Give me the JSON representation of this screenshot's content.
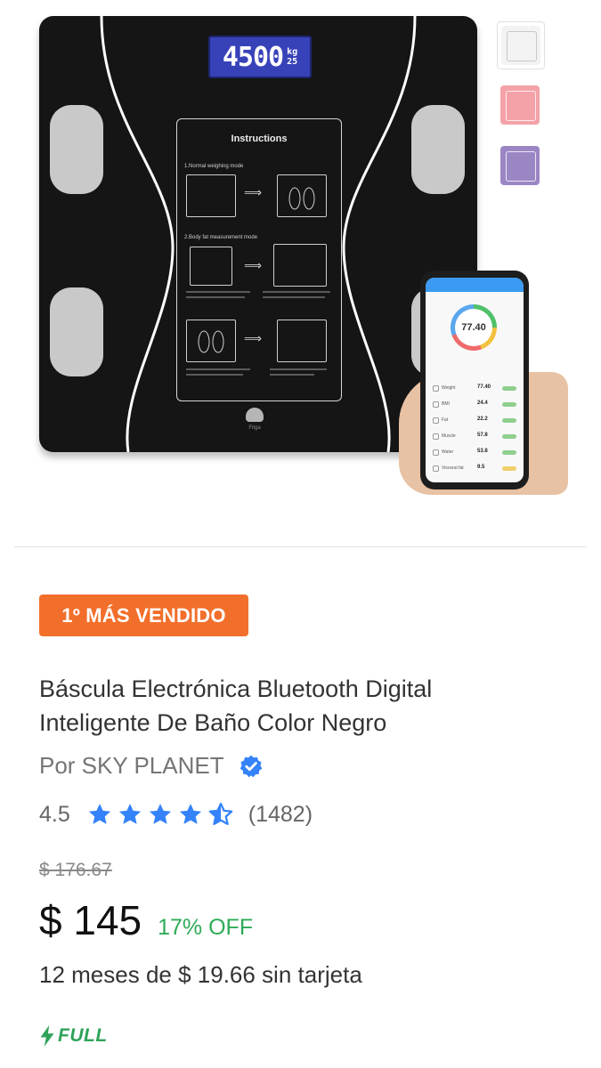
{
  "gallery": {
    "lcd_value": "4500",
    "lcd_unit": "kg",
    "lcd_temp": "25",
    "instructions_title": "Instructions",
    "step_1": "1.Normal weighing mode",
    "step_2": "2.Body fat measurement mode",
    "brand_mark": "Fitga",
    "app_reading": "77.40",
    "app_metrics": [
      {
        "name": "Weight",
        "value": "77.40"
      },
      {
        "name": "BMI",
        "value": "24.4"
      },
      {
        "name": "Fat",
        "value": "22.2"
      },
      {
        "name": "Muscle",
        "value": "57.8"
      },
      {
        "name": "Water",
        "value": "53.8"
      },
      {
        "name": "Visceral fat",
        "value": "9.5"
      }
    ],
    "thumbnails": [
      {
        "label": "white",
        "color": "#f3f3f3"
      },
      {
        "label": "pink",
        "color": "#f4a2a8"
      },
      {
        "label": "purple",
        "color": "#9b86c4"
      }
    ]
  },
  "product": {
    "badge": "1º MÁS VENDIDO",
    "badge_color": "#f26f2b",
    "title_line1": "Báscula Electrónica Bluetooth Digital",
    "title_line2": "Inteligente De Baño Color Negro",
    "seller": "Por SKY PLANET",
    "seller_verified_icon": "verified-check-icon",
    "rating": "4.5",
    "rating_value": 4.5,
    "review_count": "(1482)",
    "star_color": "#3483fa",
    "original_price": "$ 176.67",
    "price": "$ 145",
    "discount": "17% OFF",
    "discount_color": "#00a650",
    "installments": "12 meses de $ 19.66 sin tarjeta",
    "shipping": "FULL",
    "shipping_icon": "lightning-bolt-icon"
  }
}
